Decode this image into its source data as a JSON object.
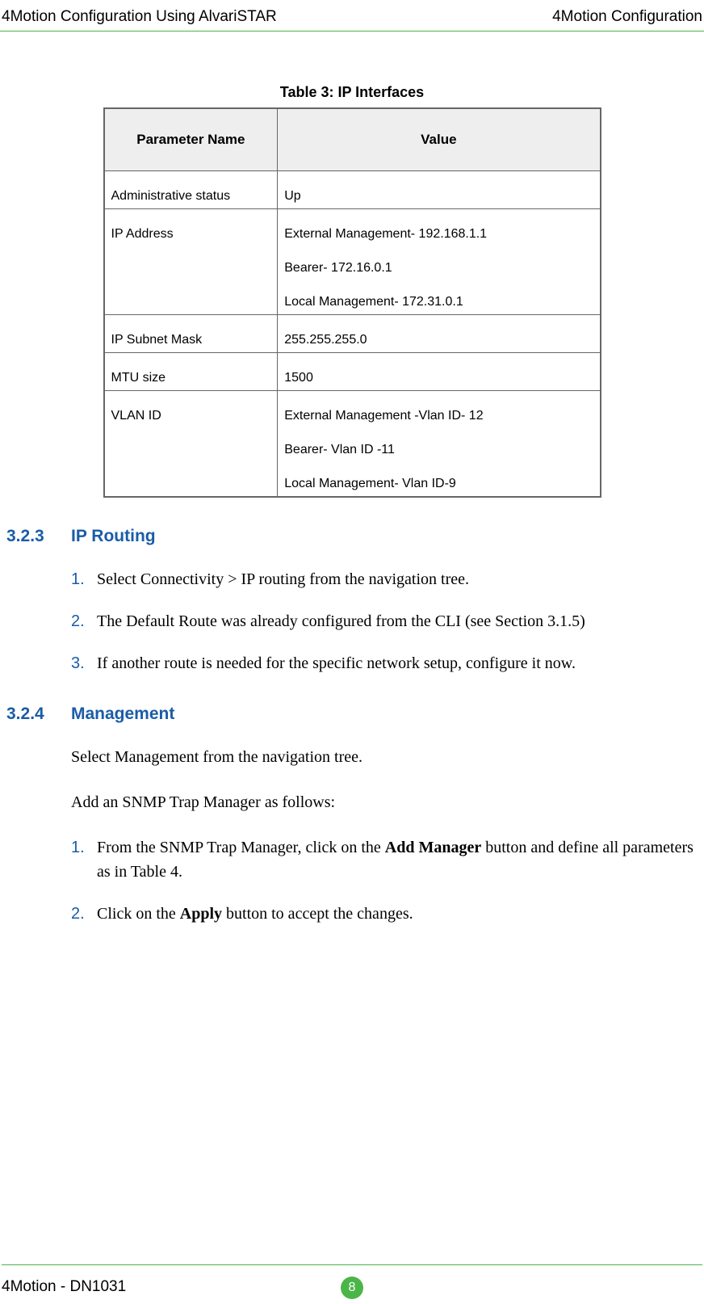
{
  "header": {
    "left": "4Motion Configuration Using AlvariSTAR",
    "right": "4Motion Configuration"
  },
  "table": {
    "caption": "Table 3: IP Interfaces",
    "col_param": "Parameter Name",
    "col_value": "Value",
    "rows": [
      {
        "param": "Administrative status",
        "value": "Up"
      },
      {
        "param": "IP Address",
        "value_lines": [
          "External Management- 192.168.1.1",
          "Bearer- 172.16.0.1",
          "Local Management- 172.31.0.1"
        ]
      },
      {
        "param": "IP Subnet Mask",
        "value": "255.255.255.0"
      },
      {
        "param": "MTU size",
        "value": "1500"
      },
      {
        "param": "VLAN ID",
        "value_lines": [
          "External Management -Vlan ID- 12",
          "Bearer- Vlan ID -11",
          "Local Management- Vlan ID-9"
        ]
      }
    ]
  },
  "section_323": {
    "num": "3.2.3",
    "title": "IP Routing",
    "items": [
      {
        "n": "1.",
        "text": "Select Connectivity > IP routing from the navigation tree."
      },
      {
        "n": "2.",
        "text": "The Default Route was already configured from the CLI (see Section 3.1.5)"
      },
      {
        "n": "3.",
        "text": "If another route is needed for the specific network setup, configure it now."
      }
    ]
  },
  "section_324": {
    "num": "3.2.4",
    "title": "Management",
    "para1": "Select Management from the navigation tree.",
    "para2": "Add an SNMP Trap Manager as follows:",
    "items": [
      {
        "n": "1.",
        "pre": "From the SNMP Trap Manager, click on the ",
        "bold": "Add Manager",
        "post": " button and define all parameters as in Table 4."
      },
      {
        "n": "2.",
        "pre": "Click on the ",
        "bold": "Apply",
        "post": " button to accept the changes."
      }
    ]
  },
  "footer": {
    "left": "4Motion - DN1031",
    "page": "8"
  }
}
